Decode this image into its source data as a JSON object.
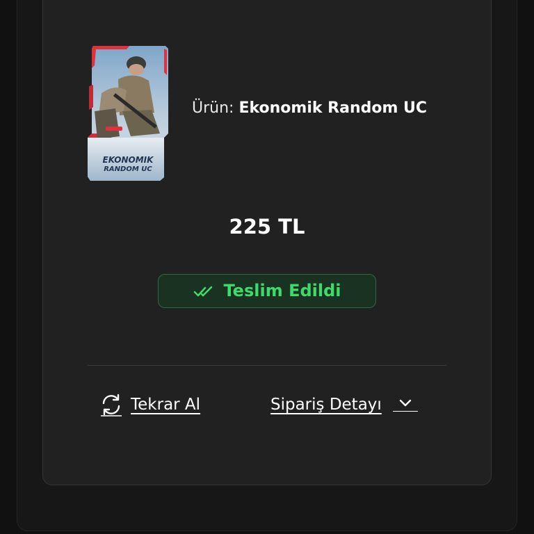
{
  "product": {
    "image_alt": "Ekonomik Random UC",
    "image_title_line1": "EKONOMIK",
    "image_title_line2": "RANDOM UC",
    "label_prefix": "Ürün: ",
    "name": "Ekonomik Random UC"
  },
  "price": "225 TL",
  "status": {
    "label": "Teslim Edildi",
    "icon": "double-check-icon",
    "color": "#3ddc6a"
  },
  "actions": {
    "reorder_label": "Tekrar Al",
    "reorder_icon": "refresh-icon",
    "details_label": "Sipariş Detayı",
    "details_icon": "chevron-down-icon"
  }
}
